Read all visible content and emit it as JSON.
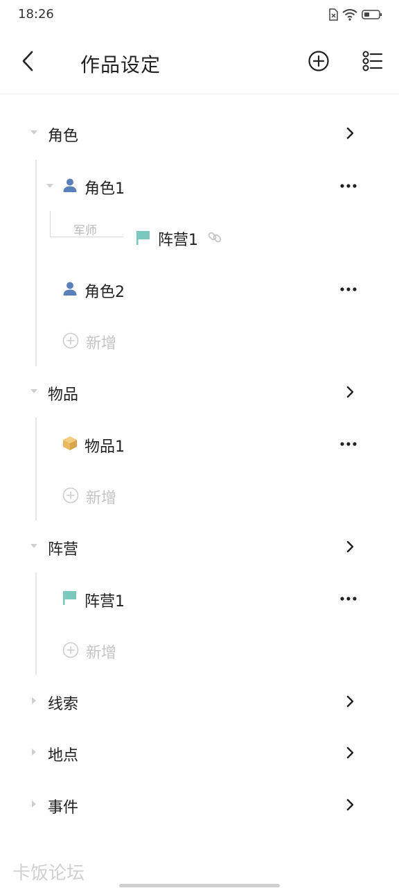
{
  "status": {
    "time": "18:26"
  },
  "header": {
    "title": "作品设定"
  },
  "sections": {
    "roles": {
      "label": "角色",
      "items": [
        {
          "label": "角色1",
          "relation": {
            "label": "军师",
            "target": "阵营1"
          }
        },
        {
          "label": "角色2"
        }
      ],
      "add_label": "新增"
    },
    "objects": {
      "label": "物品",
      "items": [
        {
          "label": "物品1"
        }
      ],
      "add_label": "新增"
    },
    "factions": {
      "label": "阵营",
      "items": [
        {
          "label": "阵营1"
        }
      ],
      "add_label": "新增"
    },
    "clues": {
      "label": "线索"
    },
    "places": {
      "label": "地点"
    },
    "events": {
      "label": "事件"
    }
  },
  "colors": {
    "person": "#5b7fb9",
    "flag": "#7cc8bd",
    "box": "#e8b860",
    "muted": "#c4c4c4"
  },
  "watermark": "卡饭论坛"
}
